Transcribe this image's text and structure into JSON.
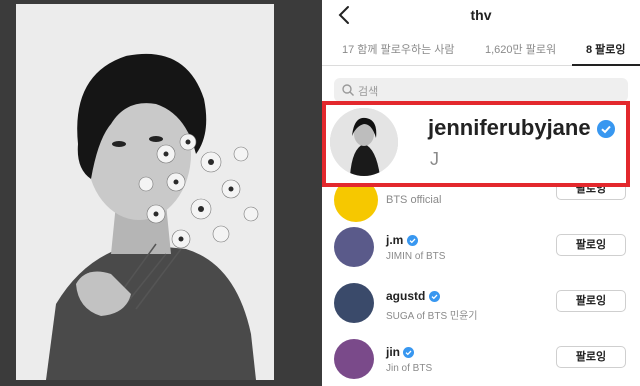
{
  "header": {
    "title": "thv"
  },
  "tabs": [
    {
      "label": "17 함께 팔로우하는 사람",
      "active": false
    },
    {
      "label": "1,620만 팔로워",
      "active": false
    },
    {
      "label": "8 팔로잉",
      "active": true
    }
  ],
  "search": {
    "placeholder": "검색"
  },
  "highlighted_account": {
    "username": "jenniferubyjane",
    "full_name": "J",
    "verified": true
  },
  "following": [
    {
      "username": "",
      "full_name": "BTS official",
      "button": "팔로잉",
      "avatar": "bts-logo-avatar"
    },
    {
      "username": "j.m",
      "full_name": "JIMIN of BTS",
      "button": "팔로잉",
      "avatar": "profile-avatar",
      "verified": true
    },
    {
      "username": "agustd",
      "full_name": "SUGA of BTS 민윤기",
      "button": "팔로잉",
      "avatar": "profile-avatar",
      "verified": true
    },
    {
      "username": "jin",
      "full_name": "Jin of BTS",
      "button": "팔로잉",
      "avatar": "profile-avatar",
      "verified": true
    }
  ],
  "colors": {
    "highlight_border": "#e3282d",
    "verified_blue": "#3897f0",
    "bts_yellow": "#f6c800"
  },
  "icons": {
    "back": "chevron-left-icon",
    "search": "search-icon",
    "verified": "verified-badge-icon"
  }
}
